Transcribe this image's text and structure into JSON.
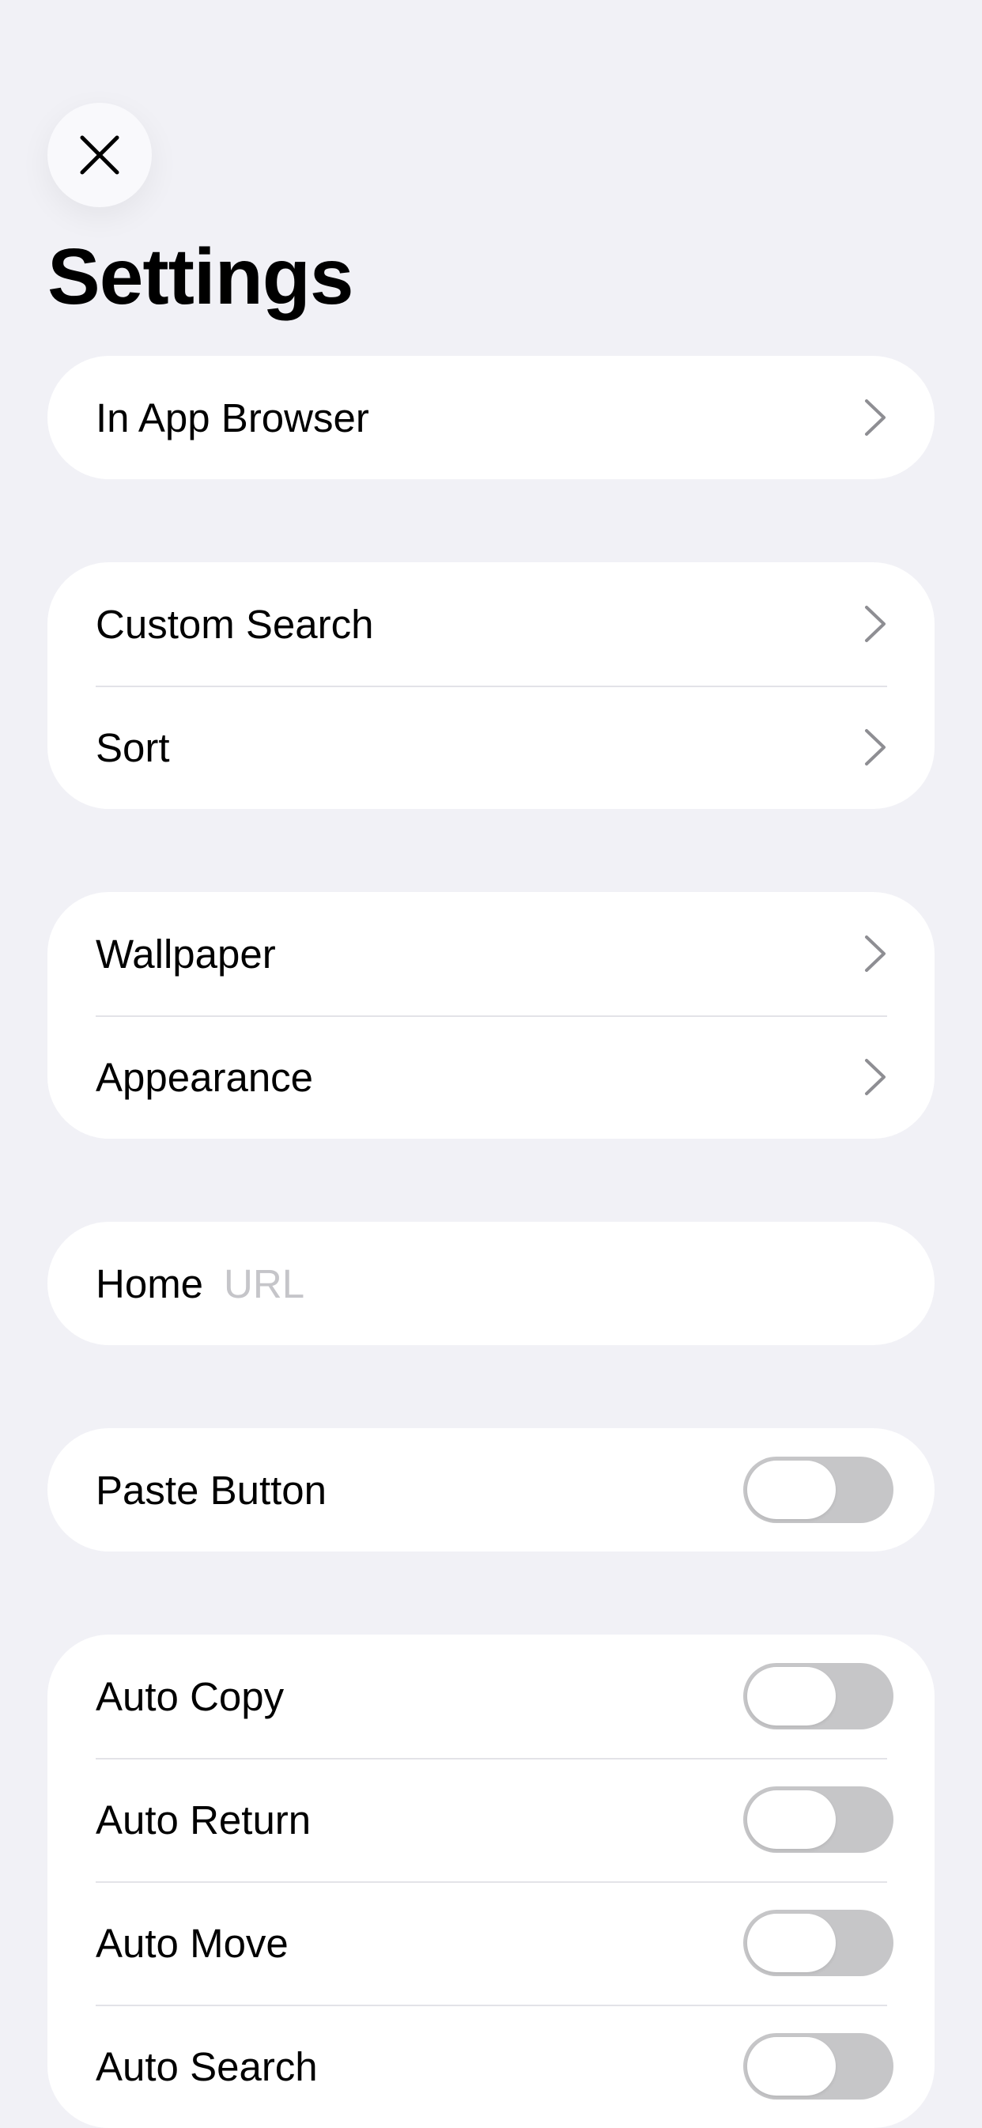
{
  "title": "Settings",
  "groups": [
    {
      "rows": [
        {
          "label": "In App Browser"
        }
      ]
    },
    {
      "rows": [
        {
          "label": "Custom Search"
        },
        {
          "label": "Sort"
        }
      ]
    },
    {
      "rows": [
        {
          "label": "Wallpaper"
        },
        {
          "label": "Appearance"
        }
      ]
    },
    {
      "rows": [
        {
          "label": "Home",
          "placeholder": "URL",
          "value": ""
        }
      ]
    },
    {
      "rows": [
        {
          "label": "Paste Button",
          "on": false
        }
      ]
    },
    {
      "rows": [
        {
          "label": "Auto Copy",
          "on": false
        },
        {
          "label": "Auto Return",
          "on": false
        },
        {
          "label": "Auto Move",
          "on": false
        },
        {
          "label": "Auto Search",
          "on": false
        }
      ]
    }
  ],
  "icons": {
    "close": "close-icon",
    "chevron": "chevron-right-icon"
  },
  "colors": {
    "background": "#F1F1F6",
    "card": "#FFFFFF",
    "toggle_off": "#C6C6C8",
    "placeholder": "#C5C5C9",
    "chevron": "#8E8E93"
  }
}
